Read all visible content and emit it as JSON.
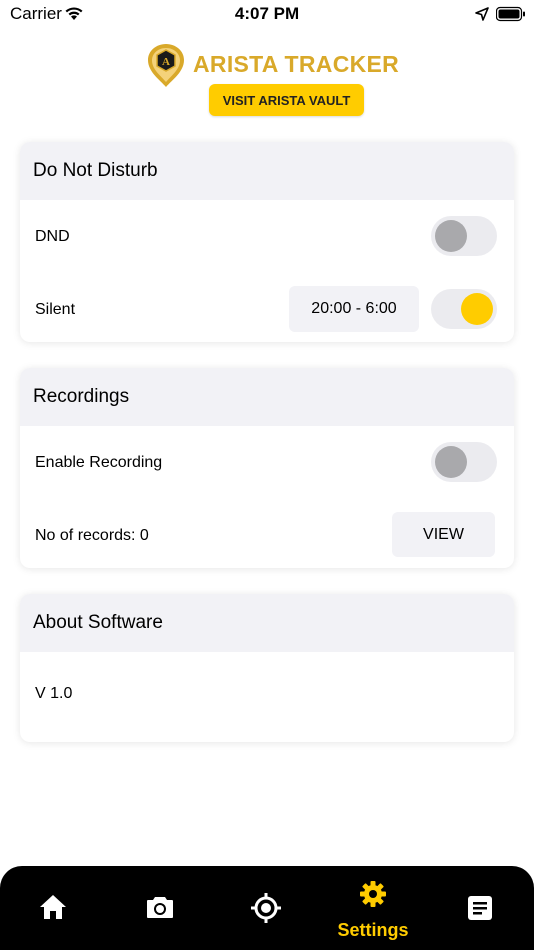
{
  "status_bar": {
    "carrier": "Carrier",
    "time": "4:07 PM"
  },
  "header": {
    "app_name": "ARISTA TRACKER",
    "logo_letter": "A",
    "vault_button": "VISIT ARISTA VAULT"
  },
  "colors": {
    "accent": "#ffcc00",
    "logo_gold": "#d9a92a",
    "tab_bar": "#000000"
  },
  "dnd_section": {
    "title": "Do Not Disturb",
    "dnd": {
      "label": "DND",
      "enabled": false
    },
    "silent": {
      "label": "Silent",
      "time_range": "20:00 - 6:00",
      "enabled": true
    }
  },
  "recordings_section": {
    "title": "Recordings",
    "enable_recording": {
      "label": "Enable Recording",
      "enabled": false
    },
    "records": {
      "label": "No of records: 0",
      "view_button": "VIEW"
    }
  },
  "about_section": {
    "title": "About Software",
    "version": "V 1.0"
  },
  "tab_bar": {
    "tabs": [
      {
        "icon": "home-icon",
        "label": ""
      },
      {
        "icon": "camera-icon",
        "label": ""
      },
      {
        "icon": "location-target-icon",
        "label": ""
      },
      {
        "icon": "settings-gear-icon",
        "label": "Settings",
        "active": true
      },
      {
        "icon": "document-icon",
        "label": ""
      }
    ]
  }
}
